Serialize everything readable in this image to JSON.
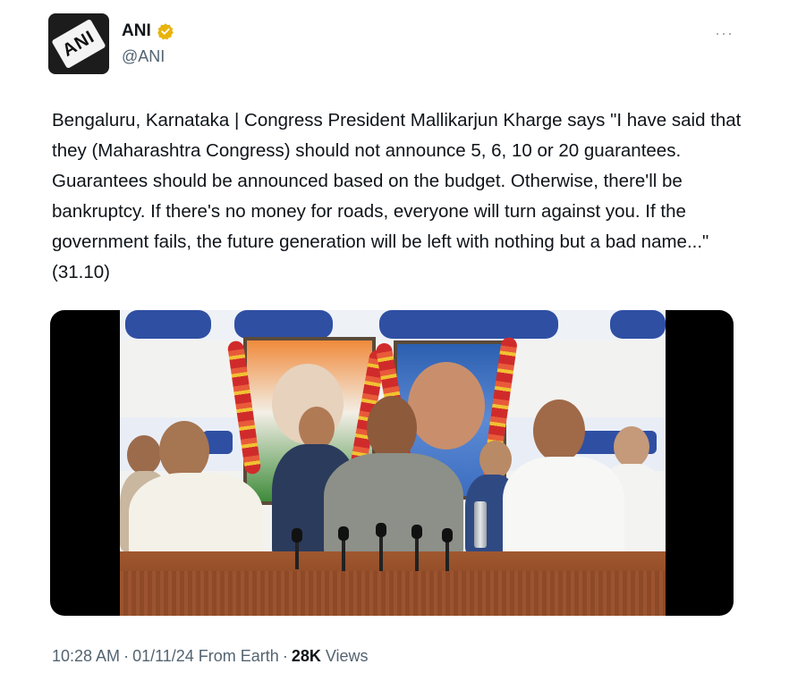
{
  "author": {
    "display_name": "ANI",
    "handle": "@ANI",
    "avatar_text": "ANI",
    "verified_badge_color": "#e8b30b"
  },
  "more_menu": {
    "icon": "more-dots-icon",
    "glyph": "···"
  },
  "tweet": {
    "text": "Bengaluru, Karnataka | Congress President Mallikarjun Kharge says \"I have said that they (Maharashtra Congress) should not announce 5, 6, 10 or 20 guarantees. Guarantees should be announced based on the budget. Otherwise, there'll be bankruptcy. If there's no money for roads, everyone will turn against you. If the government fails, the future generation will be left with nothing but a bad name...\" (31.10)"
  },
  "meta": {
    "time": "10:28 AM",
    "separator": "·",
    "date_source": "01/11/24 From Earth",
    "views_count": "28K",
    "views_label": "Views"
  },
  "colors": {
    "text_primary": "#0f1419",
    "text_secondary": "#536471",
    "media_bg": "#000000"
  }
}
